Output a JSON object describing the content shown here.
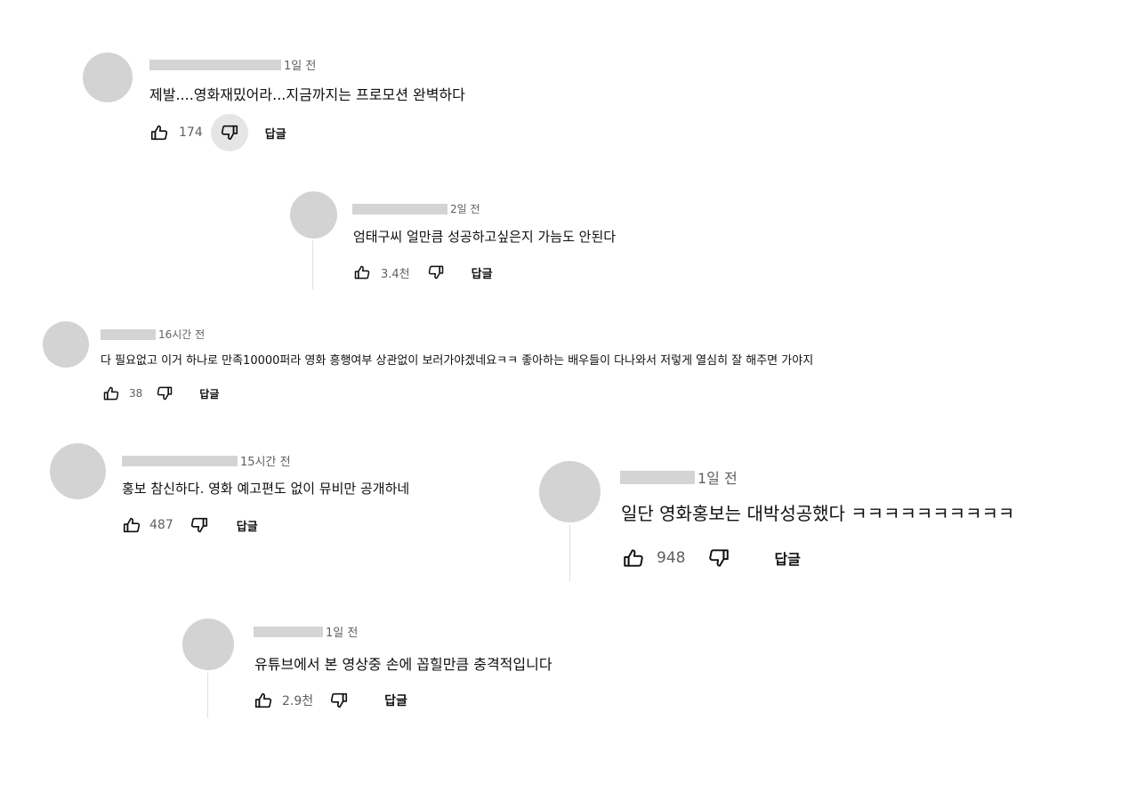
{
  "comments": [
    {
      "time": "1일 전",
      "text": "제발....영화재밌어라...지금까지는 프로모션 완벽하다",
      "likes": "174",
      "reply": "답글"
    },
    {
      "time": "2일 전",
      "text": "엄태구씨 얼만큼 성공하고싶은지 가늠도 안된다",
      "likes": "3.4천",
      "reply": "답글"
    },
    {
      "time": "16시간 전",
      "text": "다 필요없고 이거 하나로 만족10000퍼라 영화 흥행여부 상관없이 보러가야겠네요ㅋㅋ 좋아하는 배우들이 다나와서 저렇게 열심히 잘 해주면 가야지",
      "likes": "38",
      "reply": "답글"
    },
    {
      "time": "15시간 전",
      "text": "홍보 참신하다. 영화 예고편도 없이 뮤비만 공개하네",
      "likes": "487",
      "reply": "답글"
    },
    {
      "time": "1일 전",
      "text": "일단 영화홍보는 대박성공했다 ㅋㅋㅋㅋㅋㅋㅋㅋㅋㅋ",
      "likes": "948",
      "reply": "답글"
    },
    {
      "time": "1일 전",
      "text": "유튜브에서 본 영상중 손에 꼽힐만큼 충격적입니다",
      "likes": "2.9천",
      "reply": "답글"
    }
  ],
  "icons": {
    "like": "thumbs-up-icon",
    "dislike": "thumbs-down-icon"
  },
  "colors": {
    "avatar": "#d3d3d3",
    "redaction": "#d4d4d4",
    "secondary_text": "#606060"
  }
}
